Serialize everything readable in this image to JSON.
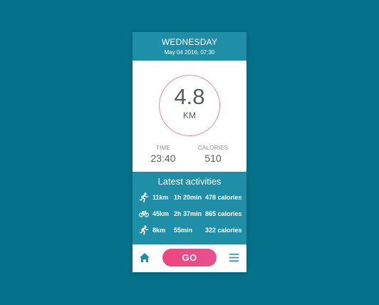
{
  "header": {
    "day": "WEDNESDAY",
    "datetime": "May 04 2016, 07:30"
  },
  "distance": {
    "value": "4.8",
    "unit": "KM"
  },
  "stats": {
    "time_label": "TIME",
    "time_value": "23:40",
    "calories_label": "CALORIES",
    "calories_value": "510"
  },
  "activities": {
    "title": "Latest activities",
    "items": [
      {
        "icon": "running-icon",
        "distance": "11km",
        "duration": "1h 20min",
        "calories": "478 calories"
      },
      {
        "icon": "bicycle-icon",
        "distance": "45km",
        "duration": "2h 37min",
        "calories": "865 calories"
      },
      {
        "icon": "running-icon",
        "distance": "8km",
        "duration": "55min",
        "calories": "322 calories"
      }
    ]
  },
  "footer": {
    "home_icon": "home-icon",
    "go_label": "GO",
    "menu_icon": "menu-icon"
  },
  "colors": {
    "background": "#06718a",
    "accent_teal": "#1f8fa8",
    "ring": "#e9899b",
    "go_button": "#f0457f"
  }
}
